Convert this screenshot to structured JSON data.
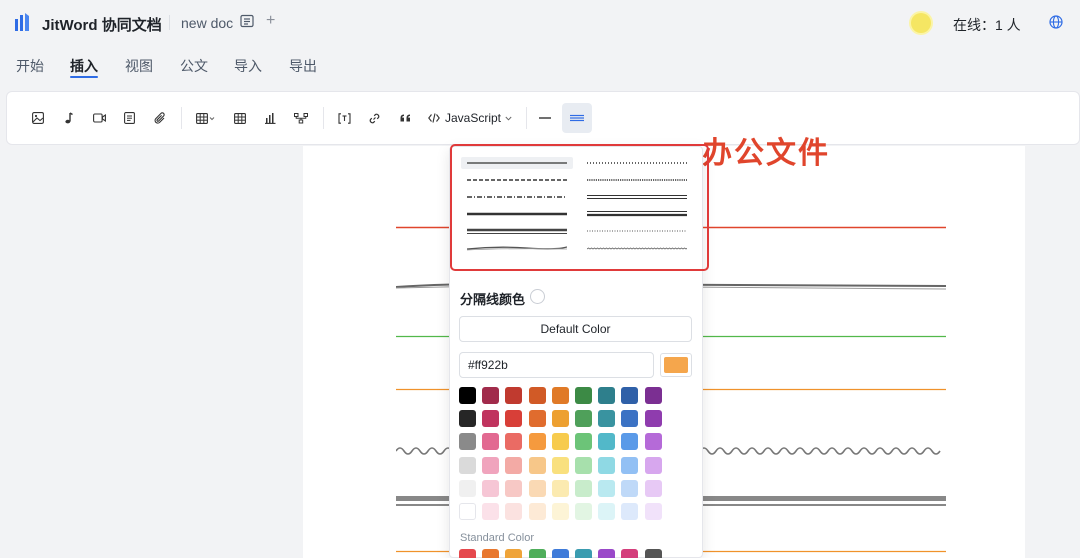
{
  "header": {
    "app_title": "JitWord 协同文档",
    "doc_name": "new doc",
    "online": "在线：1 人",
    "brand_color": "#2f6ce5"
  },
  "tabs": [
    {
      "label": "开始",
      "active": false
    },
    {
      "label": "插入",
      "active": true
    },
    {
      "label": "视图",
      "active": false
    },
    {
      "label": "公文",
      "active": false
    },
    {
      "label": "导入",
      "active": false
    },
    {
      "label": "导出",
      "active": false
    }
  ],
  "toolbar": {
    "items": [
      "image-icon",
      "audio-icon",
      "video-icon",
      "text-block-icon",
      "attachment-icon",
      "table-icon",
      "grid-icon",
      "chart-icon",
      "mindmap-icon",
      "formula-icon",
      "link-icon",
      "quote-icon",
      "code-icon",
      "divider-icon",
      "divider-style-icon"
    ],
    "code_language": "JavaScript"
  },
  "document": {
    "heading_fragment": "办公文件",
    "heading_color": "#e0452c"
  },
  "divider_popover": {
    "color_label": "分隔线颜色",
    "default_button": "Default Color",
    "hex_value": "#ff922b",
    "current_color": "#f5a64c",
    "standard_label": "Standard Color",
    "palette": [
      [
        "#000000",
        "#a12b4b",
        "#c03a2f",
        "#d15a26",
        "#e07a27",
        "#3c8a45",
        "#2e7f8c",
        "#2f60a8",
        "#7b2f92"
      ],
      [
        "#262626",
        "#c0335e",
        "#d83f38",
        "#e06c2e",
        "#eda030",
        "#4fa05a",
        "#3993a0",
        "#3b72c4",
        "#8f3cae"
      ],
      [
        "#8a8a8a",
        "#e26991",
        "#ea6b64",
        "#f59a3e",
        "#f7cb4d",
        "#6cc478",
        "#52b8c9",
        "#5a9ae8",
        "#b56ad8"
      ],
      [
        "#dadada",
        "#f0a4bd",
        "#f3aaa5",
        "#f7c789",
        "#f9e07e",
        "#a7e0ac",
        "#8fd9e4",
        "#92c0f4",
        "#d7a7ee"
      ],
      [
        "#f0f0f0",
        "#f6c6d5",
        "#f7c8c5",
        "#fad9b4",
        "#fbeab0",
        "#c8eccb",
        "#b9e9f0",
        "#bfd9f8",
        "#e7c9f5"
      ],
      [
        "#ffffff",
        "#fbe1e9",
        "#fbe2e0",
        "#fdead6",
        "#fdf4d6",
        "#e2f5e3",
        "#dcf4f7",
        "#dde9fb",
        "#f1e2fa"
      ]
    ],
    "standard_colors": [
      "#e5484d",
      "#e8772e",
      "#efa43a",
      "#4fae5b",
      "#3f7bd9",
      "#3b9cb0",
      "#9a49c9",
      "#d43e7c",
      "#555555"
    ]
  },
  "content_lines": {
    "colors": [
      "#e0452c",
      "#555555",
      "#52b84a",
      "#f0922b",
      "#888888",
      "#777777",
      "#f0922b"
    ]
  }
}
